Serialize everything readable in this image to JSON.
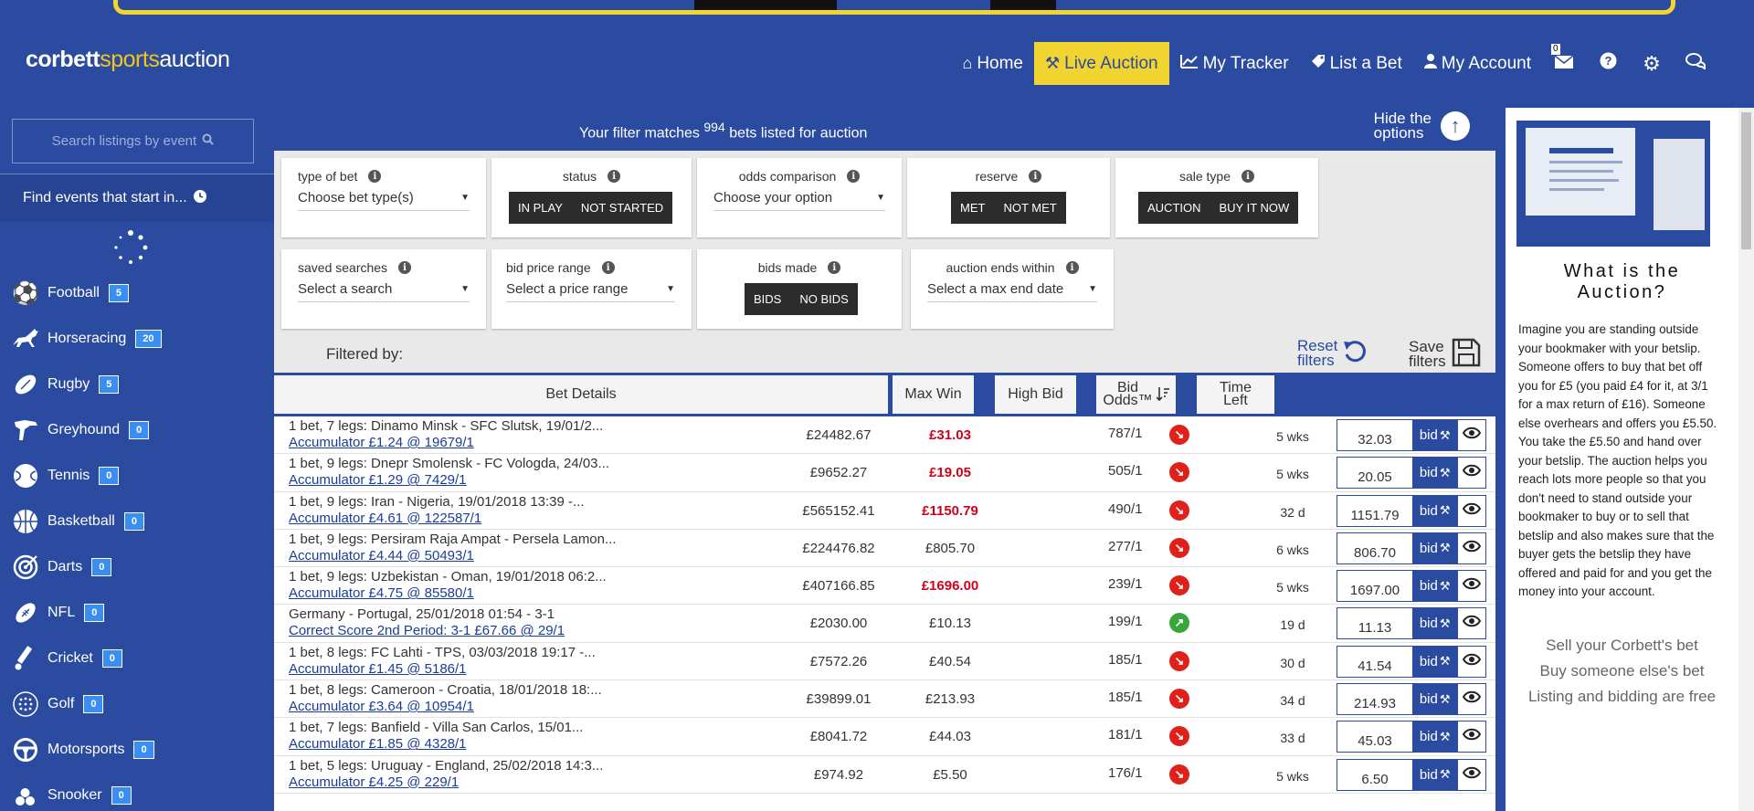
{
  "header": {
    "logo": {
      "part1": "corbett",
      "part2": "sports",
      "part3": "auction"
    },
    "nav": [
      {
        "label": "Home",
        "icon": "home-icon",
        "active": false
      },
      {
        "label": "Live Auction",
        "icon": "gavel-icon",
        "active": true
      },
      {
        "label": "My Tracker",
        "icon": "chart-icon",
        "active": false
      },
      {
        "label": "List a Bet",
        "icon": "tag-icon",
        "active": false
      },
      {
        "label": "My Account",
        "icon": "user-icon",
        "active": false
      }
    ],
    "mail_count": "0"
  },
  "sidebar": {
    "search_placeholder": "Search listings by event",
    "find_events": "Find events that start in...",
    "sports": [
      {
        "name": "Football",
        "count": "5",
        "icon": "football-icon"
      },
      {
        "name": "Horseracing",
        "count": "20",
        "icon": "horse-icon"
      },
      {
        "name": "Rugby",
        "count": "5",
        "icon": "rugby-icon"
      },
      {
        "name": "Greyhound",
        "count": "0",
        "icon": "greyhound-icon"
      },
      {
        "name": "Tennis",
        "count": "0",
        "icon": "tennis-icon"
      },
      {
        "name": "Basketball",
        "count": "0",
        "icon": "basketball-icon"
      },
      {
        "name": "Darts",
        "count": "0",
        "icon": "darts-icon"
      },
      {
        "name": "NFL",
        "count": "0",
        "icon": "nfl-icon"
      },
      {
        "name": "Cricket",
        "count": "0",
        "icon": "cricket-icon"
      },
      {
        "name": "Golf",
        "count": "0",
        "icon": "golf-icon"
      },
      {
        "name": "Motorsports",
        "count": "0",
        "icon": "motorsports-icon"
      },
      {
        "name": "Snooker",
        "count": "0",
        "icon": "snooker-icon"
      }
    ]
  },
  "filter": {
    "msg_pre": "Your filter matches",
    "count": "994",
    "msg_post": "bets listed for auction",
    "hide_line1": "Hide the",
    "hide_line2": "options"
  },
  "options": {
    "type_of_bet": {
      "title": "type of bet",
      "value": "Choose bet type(s)"
    },
    "status": {
      "title": "status",
      "buttons": [
        "IN PLAY",
        "NOT STARTED"
      ]
    },
    "odds_comparison": {
      "title": "odds comparison",
      "value": "Choose your option"
    },
    "reserve": {
      "title": "reserve",
      "buttons": [
        "MET",
        "NOT MET"
      ]
    },
    "sale_type": {
      "title": "sale type",
      "buttons": [
        "AUCTION",
        "BUY IT NOW"
      ]
    },
    "saved_searches": {
      "title": "saved searches",
      "value": "Select a search"
    },
    "bid_price_range": {
      "title": "bid price range",
      "value": "Select a price range"
    },
    "bids_made": {
      "title": "bids made",
      "buttons": [
        "BIDS",
        "NO BIDS"
      ]
    },
    "auction_ends": {
      "title": "auction ends within",
      "value": "Select a max end date"
    }
  },
  "filtered_by": "Filtered by:",
  "reset_filters": {
    "line1": "Reset",
    "line2": "filters"
  },
  "save_filters": {
    "line1": "Save",
    "line2": "filters"
  },
  "table": {
    "headers": {
      "details": "Bet Details",
      "maxwin": "Max Win",
      "highbid": "High Bid",
      "odds_line1": "Bid",
      "odds_line2": "Odds™",
      "time_line1": "Time",
      "time_line2": "Left"
    },
    "bid_label": "bid",
    "rows": [
      {
        "desc": "1 bet, 7 legs: Dinamo Minsk - SFC Slutsk,  19/01/2...",
        "link": "Accumulator £1.24 @ 19679/1",
        "maxwin": "£24482.67",
        "highbid": "£31.03",
        "red": true,
        "odds": "787/1",
        "trend": "down",
        "time": "5 wks",
        "bid": "32.03"
      },
      {
        "desc": "1 bet, 9 legs: Dnepr Smolensk - FC Vologda,  24/03...",
        "link": "Accumulator £1.29 @ 7429/1",
        "maxwin": "£9652.27",
        "highbid": "£19.05",
        "red": true,
        "odds": "505/1",
        "trend": "down",
        "time": "5 wks",
        "bid": "20.05"
      },
      {
        "desc": "1 bet, 9 legs: Iran - Nigeria,  19/01/2018 13:39 -...",
        "link": "Accumulator £4.61 @ 122587/1",
        "maxwin": "£565152.41",
        "highbid": "£1150.79",
        "red": true,
        "odds": "490/1",
        "trend": "down",
        "time": "32 d",
        "bid": "1151.79"
      },
      {
        "desc": "1 bet, 9 legs: Persiram Raja Ampat - Persela Lamon...",
        "link": "Accumulator £4.44 @ 50493/1",
        "maxwin": "£224476.82",
        "highbid": "£805.70",
        "red": false,
        "odds": "277/1",
        "trend": "down",
        "time": "6 wks",
        "bid": "806.70"
      },
      {
        "desc": "1 bet, 9 legs: Uzbekistan - Oman,  19/01/2018 06:2...",
        "link": "Accumulator £4.75 @ 85580/1",
        "maxwin": "£407166.85",
        "highbid": "£1696.00",
        "red": true,
        "odds": "239/1",
        "trend": "down",
        "time": "5 wks",
        "bid": "1697.00"
      },
      {
        "desc": "Germany - Portugal,  25/01/2018 01:54 - 3-1",
        "link": "Correct Score 2nd Period: 3-1 £67.66 @ 29/1",
        "maxwin": "£2030.00",
        "highbid": "£10.13",
        "red": false,
        "odds": "199/1",
        "trend": "up",
        "time": "19 d",
        "bid": "11.13"
      },
      {
        "desc": "1 bet, 8 legs: FC Lahti - TPS,  03/03/2018 19:17 -...",
        "link": "Accumulator £1.45 @ 5186/1",
        "maxwin": "£7572.26",
        "highbid": "£40.54",
        "red": false,
        "odds": "185/1",
        "trend": "down",
        "time": "30 d",
        "bid": "41.54"
      },
      {
        "desc": "1 bet, 8 legs: Cameroon - Croatia,  18/01/2018 18:...",
        "link": "Accumulator £3.64 @ 10954/1",
        "maxwin": "£39899.01",
        "highbid": "£213.93",
        "red": false,
        "odds": "185/1",
        "trend": "down",
        "time": "34 d",
        "bid": "214.93"
      },
      {
        "desc": "1 bet, 7 legs: Banfield - Villa San Carlos,  15/01...",
        "link": "Accumulator £1.85 @ 4328/1",
        "maxwin": "£8041.72",
        "highbid": "£44.03",
        "red": false,
        "odds": "181/1",
        "trend": "down",
        "time": "33 d",
        "bid": "45.03"
      },
      {
        "desc": "1 bet, 5 legs: Uruguay - England,  25/02/2018 14:3...",
        "link": "Accumulator £4.25 @ 229/1",
        "maxwin": "£974.92",
        "highbid": "£5.50",
        "red": false,
        "odds": "176/1",
        "trend": "down",
        "time": "5 wks",
        "bid": "6.50"
      }
    ]
  },
  "right_panel": {
    "title_line1": "What is the",
    "title_line2": "Auction?",
    "text": "Imagine you are standing outside your bookmaker with your betslip. Someone offers to buy that bet off you for £5 (you paid £4 for it, at 3/1 for a max return of £16). Someone else overhears and offers you £5.50. You take the £5.50 and hand over your betslip. The auction helps you reach lots more people so that you don't need to stand outside your bookmaker to buy or to sell that betslip and also makes sure that the buyer gets the betslip they have offered and paid for and you get the money into your account.",
    "tag1": "Sell your Corbett's bet",
    "tag2": "Buy someone else's bet",
    "tag3": "Listing and bidding are free"
  },
  "colors": {
    "brand": "#2a4b9f",
    "accent": "#f2d431",
    "bid_red": "#d0021b",
    "trend_down": "#e0201b",
    "trend_up": "#3aa53a"
  }
}
